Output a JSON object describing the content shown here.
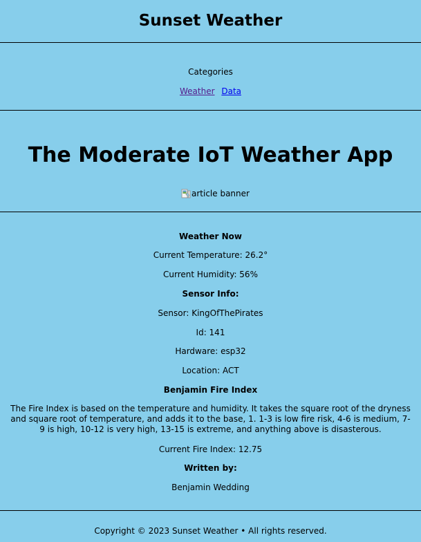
{
  "site": {
    "title": "Sunset Weather"
  },
  "nav": {
    "heading": "Categories",
    "links": [
      {
        "label": "Weather"
      },
      {
        "label": "Data"
      }
    ]
  },
  "article": {
    "title": "The Moderate IoT Weather App",
    "banner_alt": "article banner"
  },
  "weather": {
    "heading": "Weather Now",
    "temperature": "Current Temperature: 26.2°",
    "humidity": "Current Humidity: 56%"
  },
  "sensor": {
    "heading": "Sensor Info:",
    "name": "Sensor: KingOfThePirates",
    "id": "Id: 141",
    "hardware": "Hardware: esp32",
    "location": "Location: ACT"
  },
  "fire_index": {
    "heading": "Benjamin Fire Index",
    "description": "The Fire Index is based on the temperature and humidity. It takes the square root of the dryness and square root of temperature, and adds it to the base, 1. 1-3 is low fire risk, 4-6 is medium, 7-9 is high, 10-12 is very high, 13-15 is extreme, and anything above is disasterous.",
    "current": "Current Fire Index: 12.75"
  },
  "author": {
    "heading": "Written by:",
    "name": "Benjamin Wedding"
  },
  "footer": {
    "copyright": "Copyright © 2023 Sunset Weather • All rights reserved."
  }
}
